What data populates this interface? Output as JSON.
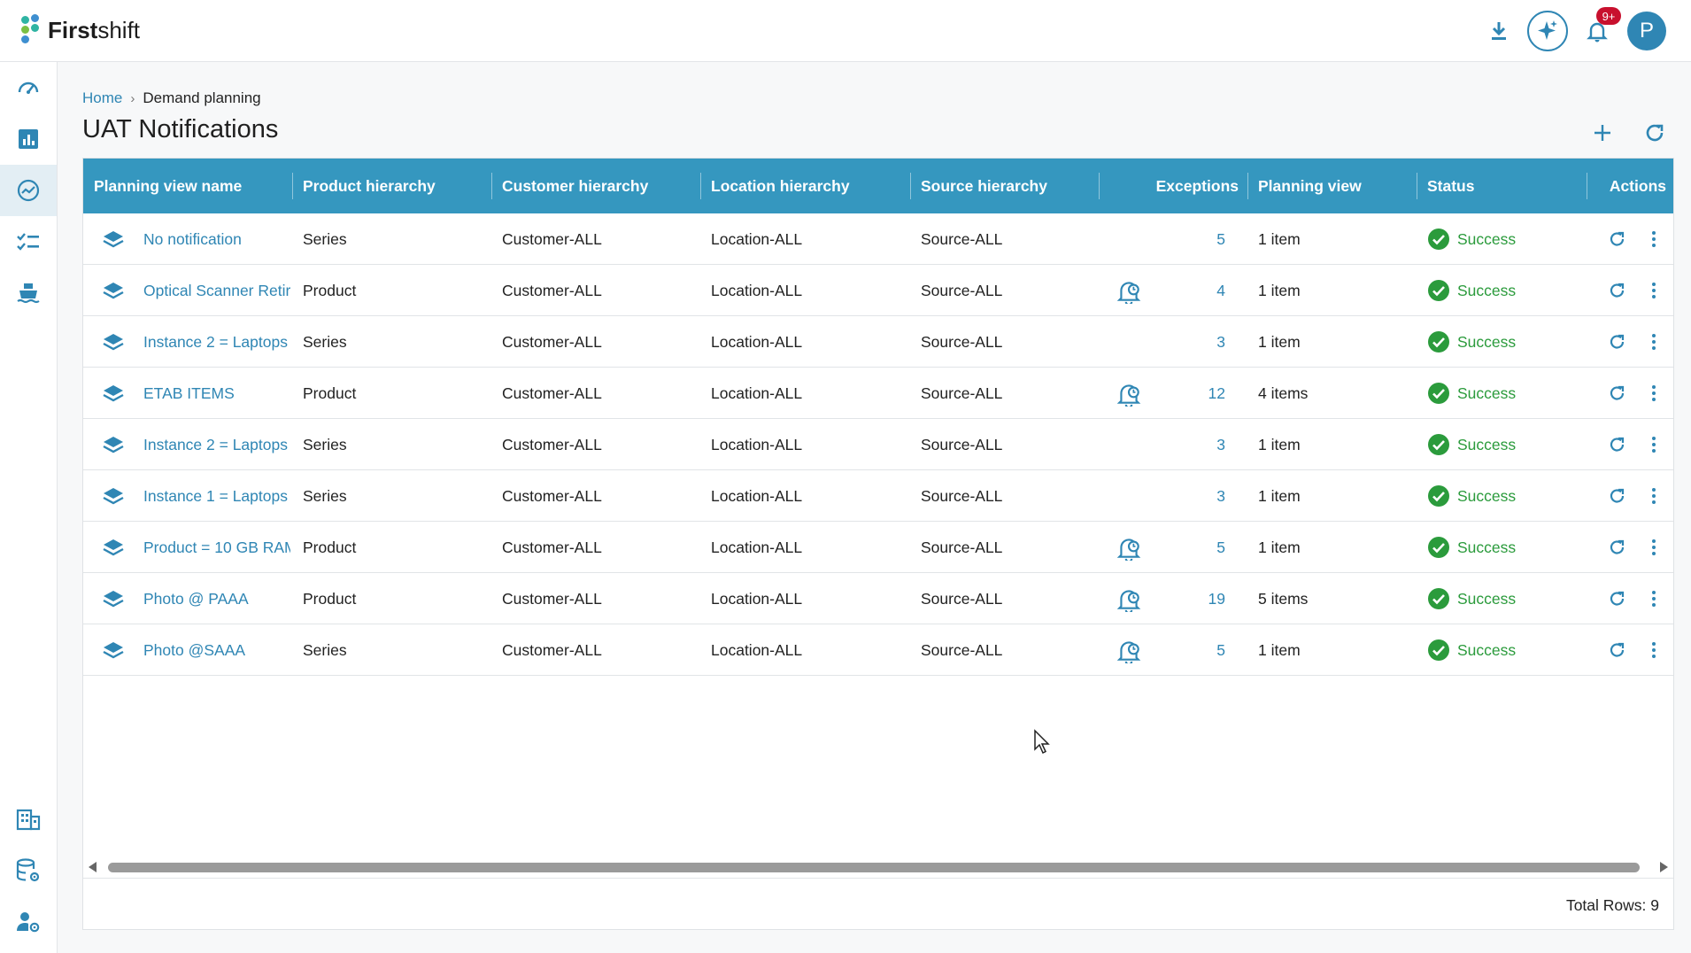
{
  "app": {
    "name_bold": "First",
    "name_rest": "shift"
  },
  "header": {
    "notification_badge": "9+",
    "avatar_letter": "P"
  },
  "breadcrumb": {
    "home": "Home",
    "separator": "›",
    "current": "Demand planning"
  },
  "page": {
    "title": "UAT Notifications"
  },
  "table": {
    "columns": [
      "Planning view name",
      "Product hierarchy",
      "Customer hierarchy",
      "Location hierarchy",
      "Source hierarchy",
      "Exceptions",
      "Planning view",
      "Status",
      "Actions"
    ],
    "rows": [
      {
        "name": "No notification",
        "product": "Series",
        "customer": "Customer-ALL",
        "location": "Location-ALL",
        "source": "Source-ALL",
        "has_alert": false,
        "exceptions": "5",
        "planning_view": "1 item",
        "status": "Success"
      },
      {
        "name": "Optical Scanner Retir",
        "product": "Product",
        "customer": "Customer-ALL",
        "location": "Location-ALL",
        "source": "Source-ALL",
        "has_alert": true,
        "exceptions": "4",
        "planning_view": "1 item",
        "status": "Success"
      },
      {
        "name": "Instance 2 = Laptops",
        "product": "Series",
        "customer": "Customer-ALL",
        "location": "Location-ALL",
        "source": "Source-ALL",
        "has_alert": false,
        "exceptions": "3",
        "planning_view": "1 item",
        "status": "Success"
      },
      {
        "name": "ETAB ITEMS",
        "product": "Product",
        "customer": "Customer-ALL",
        "location": "Location-ALL",
        "source": "Source-ALL",
        "has_alert": true,
        "exceptions": "12",
        "planning_view": "4 items",
        "status": "Success"
      },
      {
        "name": "Instance 2 = Laptops",
        "product": "Series",
        "customer": "Customer-ALL",
        "location": "Location-ALL",
        "source": "Source-ALL",
        "has_alert": false,
        "exceptions": "3",
        "planning_view": "1 item",
        "status": "Success"
      },
      {
        "name": "Instance 1 = Laptops",
        "product": "Series",
        "customer": "Customer-ALL",
        "location": "Location-ALL",
        "source": "Source-ALL",
        "has_alert": false,
        "exceptions": "3",
        "planning_view": "1 item",
        "status": "Success"
      },
      {
        "name": "Product = 10 GB RAM",
        "product": "Product",
        "customer": "Customer-ALL",
        "location": "Location-ALL",
        "source": "Source-ALL",
        "has_alert": true,
        "exceptions": "5",
        "planning_view": "1 item",
        "status": "Success"
      },
      {
        "name": "Photo @ PAAA",
        "product": "Product",
        "customer": "Customer-ALL",
        "location": "Location-ALL",
        "source": "Source-ALL",
        "has_alert": true,
        "exceptions": "19",
        "planning_view": "5 items",
        "status": "Success"
      },
      {
        "name": "Photo @SAAA",
        "product": "Series",
        "customer": "Customer-ALL",
        "location": "Location-ALL",
        "source": "Source-ALL",
        "has_alert": true,
        "exceptions": "5",
        "planning_view": "1 item",
        "status": "Success"
      }
    ],
    "footer": "Total Rows: 9"
  },
  "icons": {
    "header": [
      "download-icon",
      "ai-sparkle-icon",
      "bell-icon",
      "avatar"
    ],
    "sidebar_top": [
      "dashboard-gauge-icon",
      "bar-chart-icon",
      "trend-chart-icon",
      "checklist-icon",
      "shipping-icon"
    ],
    "sidebar_bottom": [
      "building-icon",
      "database-settings-icon",
      "user-settings-icon"
    ],
    "row": [
      "layers-icon",
      "alert-bell-icon",
      "success-check-icon",
      "refresh-icon",
      "more-vertical-icon"
    ]
  },
  "colors": {
    "accent": "#3597bf",
    "link": "#2f86b4",
    "success": "#2b9b3c",
    "badge": "#c8102e"
  }
}
